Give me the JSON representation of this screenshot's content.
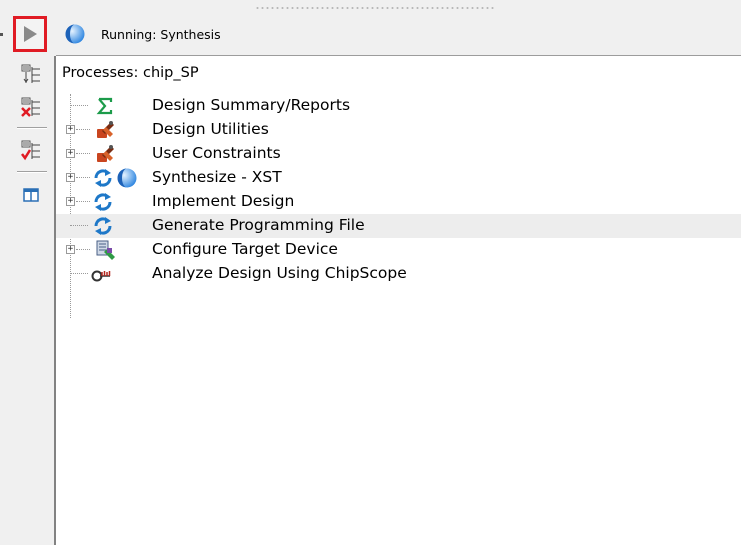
{
  "header": {
    "status_text": "Running: Synthesis",
    "status_icon": "spinning-progress-icon"
  },
  "toolbar": {
    "run_icon": "play-icon",
    "items": [
      {
        "icon": "hierarchy-view-icon"
      },
      {
        "icon": "remove-hierarchy-icon"
      },
      {
        "icon": "check-hierarchy-icon"
      },
      {
        "icon": "panel-layout-icon"
      }
    ]
  },
  "processes": {
    "title": "Processes: chip_SP",
    "items": [
      {
        "label": "Design Summary/Reports",
        "icon": "sigma-icon",
        "expandable": false
      },
      {
        "label": "Design Utilities",
        "icon": "tools-icon",
        "expandable": true
      },
      {
        "label": "User Constraints",
        "icon": "tools-icon",
        "expandable": true
      },
      {
        "label": "Synthesize - XST",
        "icon": "refresh-icon",
        "status_icon": "spinning-progress-icon",
        "expandable": true
      },
      {
        "label": "Implement Design",
        "icon": "refresh-icon",
        "expandable": true
      },
      {
        "label": "Generate Programming File",
        "icon": "refresh-icon",
        "expandable": false,
        "highlighted": true
      },
      {
        "label": "Configure Target Device",
        "icon": "device-config-icon",
        "expandable": true
      },
      {
        "label": "Analyze Design Using ChipScope",
        "icon": "chipscope-icon",
        "expandable": false
      }
    ]
  },
  "colors": {
    "highlight_border": "#e01b24",
    "refresh_blue": "#1e78c8",
    "tools_orange": "#d04020"
  }
}
